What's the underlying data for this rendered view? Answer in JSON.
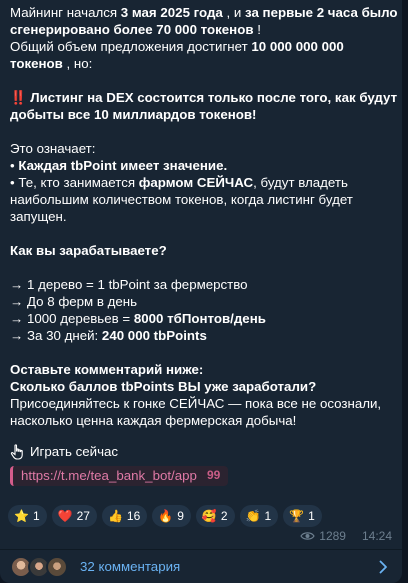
{
  "message": {
    "line1_a": "Майнинг начался ",
    "line1_b": "3 мая 2025 года",
    "line1_c": " , и ",
    "line1_d": "за первые 2 часа было сгенерировано более 70 000 токенов",
    "line1_e": " !",
    "line2_a": "Общий объем предложения достигнет ",
    "line2_b": "10 000 000 000 токенов",
    "line2_c": " , но:",
    "alert_icon": "‼️",
    "alert_text": " Листинг на DEX состоится только после того, как будут добыты все 10 миллиардов токенов!",
    "means": "Это означает:",
    "bullet1_a": "• ",
    "bullet1_b": "Каждая tbPoint имеет значение.",
    "bullet2_a": "• Те, кто занимается ",
    "bullet2_b": "фармом СЕЙЧАС",
    "bullet2_c": ", будут владеть наибольшим количеством токенов, когда листинг будет запущен.",
    "earn_title": "Как вы зарабатываете?",
    "earn1": "→ 1 дерево = 1 tbPoint за фермерство",
    "earn2": "→ До 8 ферм в день",
    "earn3_a": "→ 1000 деревьев = ",
    "earn3_b": "8000 тбПонтов/день",
    "earn4_a": "→ За 30 дней: ",
    "earn4_b": "240 000 tbPoints",
    "cta1": "Оставьте комментарий ниже:",
    "cta2": "Сколько баллов tbPoints ВЫ уже заработали?",
    "cta3": "Присоединяйтесь к гонке СЕЙЧАС — пока все не осознали, насколько ценна каждая фермерская добыча!",
    "play_label": "Играть сейчас",
    "link": "https://t.me/tea_bank_bot/app",
    "quote_icon": "99"
  },
  "reactions": [
    {
      "icon": "star-icon",
      "emoji": "⭐",
      "count": "1"
    },
    {
      "icon": "heart-icon",
      "emoji": "❤️",
      "count": "27"
    },
    {
      "icon": "thumbs-up-icon",
      "emoji": "👍",
      "count": "16"
    },
    {
      "icon": "fire-icon",
      "emoji": "🔥",
      "count": "9"
    },
    {
      "icon": "smiling-face-hearts-icon",
      "emoji": "🥰",
      "count": "2"
    },
    {
      "icon": "clapping-hands-icon",
      "emoji": "👏",
      "count": "1"
    },
    {
      "icon": "trophy-icon",
      "emoji": "🏆",
      "count": "1"
    }
  ],
  "meta": {
    "views": "1289",
    "time": "14:24"
  },
  "comments": {
    "label": "32 комментария"
  },
  "colors": {
    "background": "#0e1621",
    "bubble": "#182533",
    "link": "#6ab2f2",
    "reaction_bg": "#223447",
    "muted": "#6d7f8f"
  }
}
